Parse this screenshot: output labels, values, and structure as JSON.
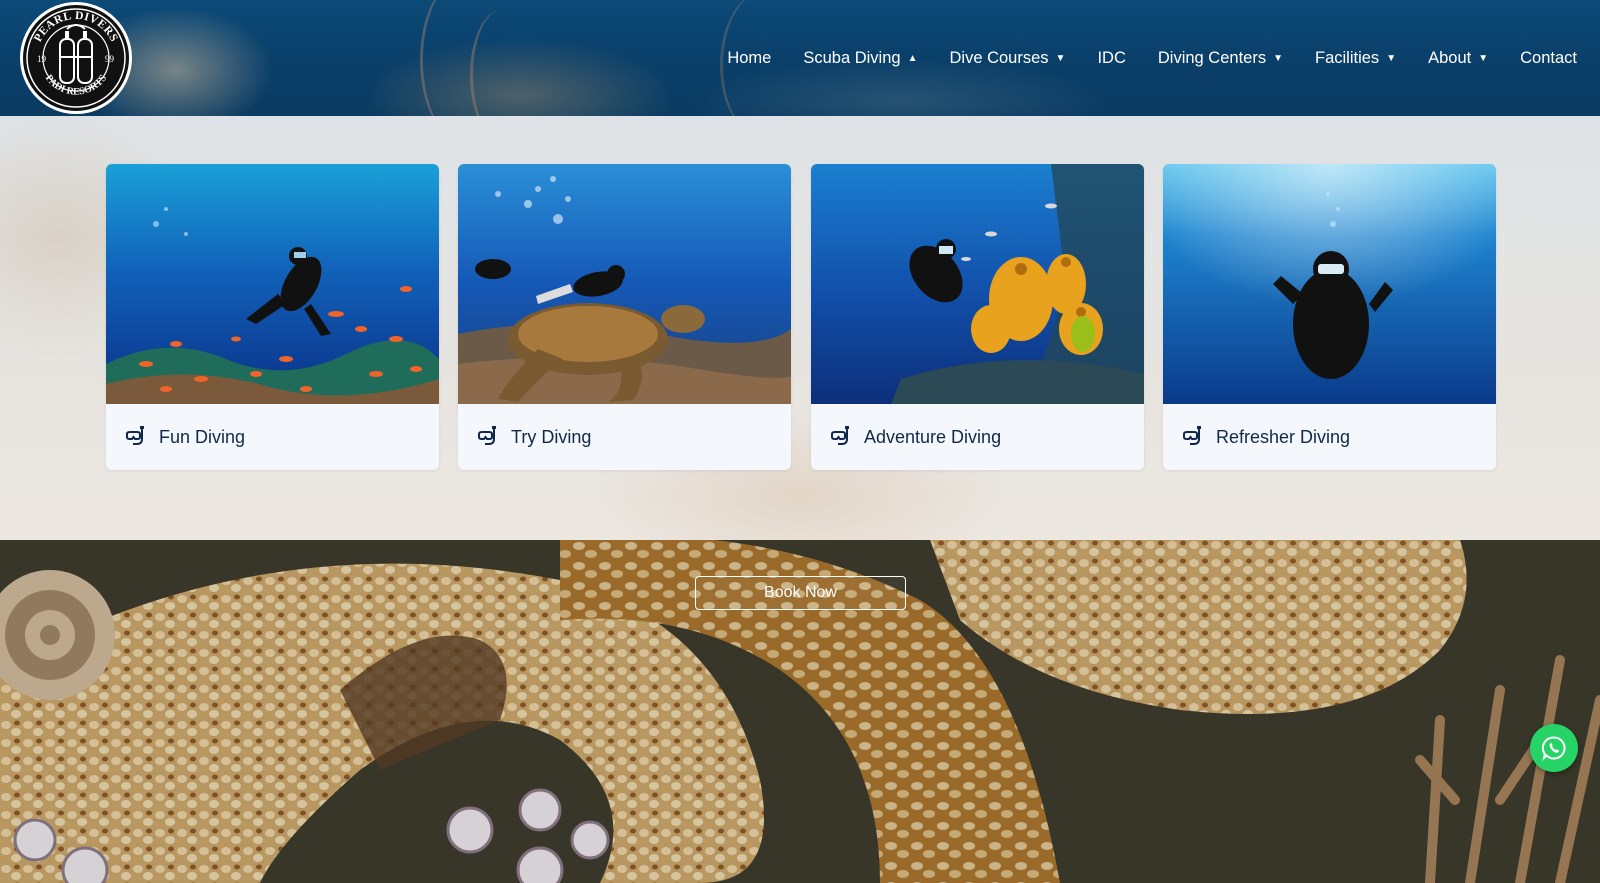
{
  "logo": {
    "top_text": "PEARL DIVERS",
    "bottom_text": "PADI RESORTS",
    "year_left": "19",
    "year_right": "99"
  },
  "nav": {
    "items": [
      {
        "label": "Home",
        "has_caret": false
      },
      {
        "label": "Scuba Diving",
        "has_caret": true,
        "caret": "up"
      },
      {
        "label": "Dive Courses",
        "has_caret": true,
        "caret": "down"
      },
      {
        "label": "IDC",
        "has_caret": false
      },
      {
        "label": "Diving Centers",
        "has_caret": true,
        "caret": "down"
      },
      {
        "label": "Facilities",
        "has_caret": true,
        "caret": "down"
      },
      {
        "label": "About",
        "has_caret": true,
        "caret": "down"
      },
      {
        "label": "Contact",
        "has_caret": false
      }
    ]
  },
  "services": [
    {
      "title": "Fun Diving",
      "icon": "snorkel-mask-icon"
    },
    {
      "title": "Try Diving",
      "icon": "snorkel-mask-icon"
    },
    {
      "title": "Adventure Diving",
      "icon": "snorkel-mask-icon"
    },
    {
      "title": "Refresher Diving",
      "icon": "snorkel-mask-icon"
    }
  ],
  "cta": {
    "book_label": "Book Now"
  },
  "floating": {
    "whatsapp_icon": "whatsapp-icon",
    "color": "#25d366"
  },
  "colors": {
    "card_title": "#12284b",
    "header_bg": "#0a3f69"
  }
}
